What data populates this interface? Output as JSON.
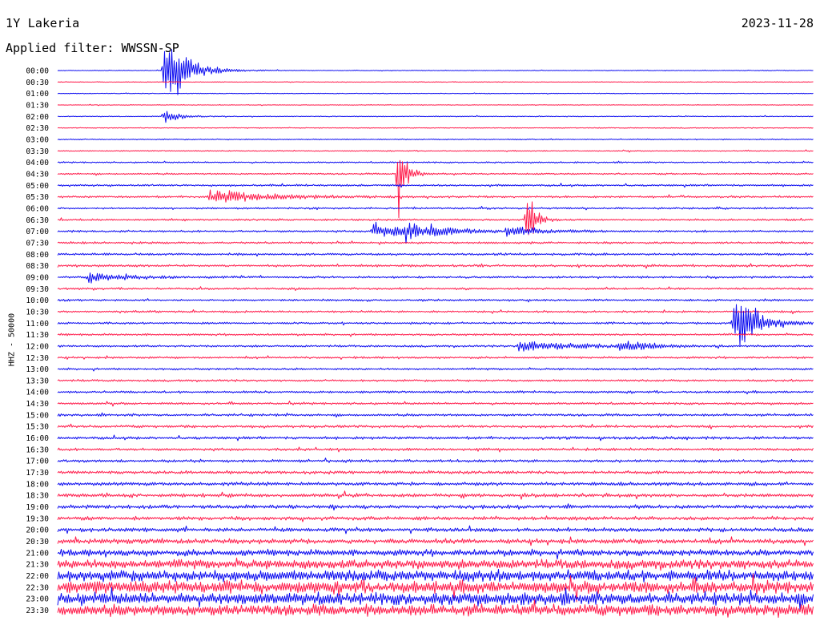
{
  "header": {
    "station": "1Y Lakeria",
    "date": "2023-11-28",
    "filter": "Applied filter: WWSSN-SP"
  },
  "channel_label": "HHZ - 50000",
  "colors": {
    "trace_a": "#0a0af0",
    "trace_b": "#ff1a4a",
    "text": "#000000",
    "background": "#ffffff"
  },
  "chart_data": {
    "type": "line",
    "chart_kind": "helicorder",
    "line_duration_minutes": 30,
    "alternating_colors": [
      "#0a0af0",
      "#ff1a4a"
    ],
    "row_labels": [
      "00:00",
      "00:30",
      "01:00",
      "01:30",
      "02:00",
      "02:30",
      "03:00",
      "03:30",
      "04:00",
      "04:30",
      "05:00",
      "05:30",
      "06:00",
      "06:30",
      "07:00",
      "07:30",
      "08:00",
      "08:30",
      "09:00",
      "09:30",
      "10:00",
      "10:30",
      "11:00",
      "11:30",
      "12:00",
      "12:30",
      "13:00",
      "13:30",
      "14:00",
      "14:30",
      "15:00",
      "15:30",
      "16:00",
      "16:30",
      "17:00",
      "17:30",
      "18:00",
      "18:30",
      "19:00",
      "19:30",
      "20:00",
      "20:30",
      "21:00",
      "21:30",
      "22:00",
      "22:30",
      "23:00",
      "23:30"
    ],
    "noise_level": [
      0.3,
      0.3,
      0.3,
      0.3,
      0.4,
      0.4,
      0.5,
      0.5,
      0.7,
      0.8,
      1.0,
      1.0,
      0.9,
      0.9,
      1.0,
      1.0,
      1.1,
      1.2,
      1.0,
      1.0,
      1.0,
      1.0,
      1.0,
      1.0,
      1.0,
      1.0,
      1.0,
      1.0,
      1.1,
      1.1,
      1.2,
      1.3,
      1.4,
      1.3,
      1.4,
      1.5,
      1.7,
      1.8,
      1.8,
      1.8,
      2.0,
      2.4,
      3.2,
      4.5,
      5.5,
      6.0,
      6.0,
      5.5
    ],
    "events": [
      {
        "row": 0,
        "minute": 4.2,
        "amplitude": 70,
        "duration": 0.8
      },
      {
        "row": 4,
        "minute": 4.2,
        "amplitude": 14,
        "duration": 0.5
      },
      {
        "row": 9,
        "minute": 13.5,
        "amplitude": 70,
        "duration": 0.3
      },
      {
        "row": 13,
        "minute": 18.6,
        "amplitude": 55,
        "duration": 0.3
      },
      {
        "row": 14,
        "minute": 12.5,
        "amplitude": 12,
        "duration": 1.5
      },
      {
        "row": 14,
        "minute": 13.8,
        "amplitude": 12,
        "duration": 1.3
      },
      {
        "row": 14,
        "minute": 17.8,
        "amplitude": 10,
        "duration": 1.2
      },
      {
        "row": 18,
        "minute": 1.2,
        "amplitude": 8,
        "duration": 1.5
      },
      {
        "row": 11,
        "minute": 6.0,
        "amplitude": 10,
        "duration": 2.2
      },
      {
        "row": 22,
        "minute": 26.8,
        "amplitude": 60,
        "duration": 0.8
      },
      {
        "row": 24,
        "minute": 18.3,
        "amplitude": 9,
        "duration": 2.2
      },
      {
        "row": 24,
        "minute": 22.3,
        "amplitude": 9,
        "duration": 1.0
      }
    ]
  }
}
